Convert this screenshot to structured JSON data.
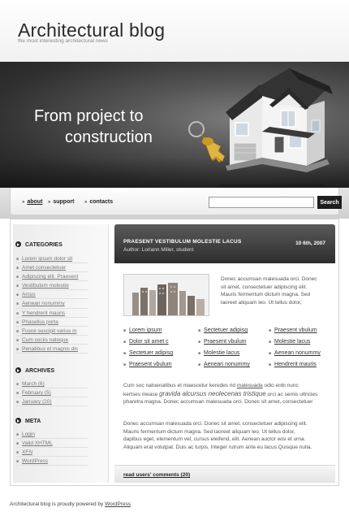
{
  "header": {
    "title": "Architectural blog",
    "tagline": "the most interesting architectural news"
  },
  "banner": {
    "headline_line1": "From project to",
    "headline_line2": "construction"
  },
  "nav": {
    "items": [
      {
        "label": "about",
        "active": true
      },
      {
        "label": "support",
        "active": false
      },
      {
        "label": "contacts",
        "active": false
      }
    ],
    "search_value": "",
    "search_button": "Search"
  },
  "sidebar": {
    "categories": {
      "title": "CATEGORIES",
      "items": [
        "Lorem ipsum dolor sit",
        "Amet consectetuer",
        "Adipiscing elit. Praesent",
        "Vestibulum molestie",
        "Arcus",
        "Aenean nonummy",
        "Y hendrerit mauris",
        "Phasellus porta",
        "Fusce suscipit varius m",
        "Cum sociis natoque",
        "Penatibus et magnis dis"
      ]
    },
    "archives": {
      "title": "ARCHIVES",
      "items": [
        "March (6)",
        "February (5)",
        "January (20)"
      ]
    },
    "meta": {
      "title": "META",
      "items": [
        "Login",
        "Valid XHTML",
        "XFN",
        "WordPress"
      ]
    }
  },
  "post": {
    "title": "PRAESENT VESTIBULUM MOLESTIE LACUS",
    "author": "Author: Lorlann Miller, student",
    "date": "10 6th, 2007",
    "intro_lines": [
      "Donec accumsan malesuada orci. Donec",
      "sit amet, consectetuer adipiscing elit.",
      "Mauris fermentum dictum magna. Sed",
      "laoreet aliquam leo. Ut tellus dolor,"
    ],
    "links": [
      [
        "Lorem ipsum",
        "Sectetuer adipisg",
        "Praesent vbulum"
      ],
      [
        "Dolor sit amet c",
        "Praesent vbulum",
        "Molestie lacus"
      ],
      [
        "Sectetuer adipisg",
        "Molestie lacus",
        "Aenean nonummy"
      ],
      [
        "Praesent vbulum",
        "Aenean nonummy",
        "Hendrerit mauris"
      ]
    ],
    "para2": {
      "line1_before": "Cum soc natoenatibus et maescetur keredes rid",
      "line1_link": "malesuada",
      "line1_after": "odio enbi nunc",
      "line2_before": "kertses mease",
      "line2_em": "gravida alcursus neolecenas tristique",
      "line2_after": "orci ac semis ultricies",
      "line3": "pharetra magna. Donec accumsan malesuada orci. Donec sit amet, consectetuer"
    },
    "para3_lines": [
      "Donec accumsan malesuada orci. Donec sit amet, consectetuer adipiscing elit.",
      "Mauris fermentum dictum magna. Sed laoreet aliquam leo. Ut tellus dolor,",
      "dapibus eget, elementum vel, cursus eleifend, elit. Aenean auctor wisi et urna.",
      "Aliquam erat volutpat. Duis ac turpis. Integer rutrum ante eu lacus.Quisque nulla."
    ],
    "comments_link": "read users' comments (20)"
  },
  "footer": {
    "text": "Architectural blog is proudly powered by",
    "link": "WordPress"
  },
  "colors": {
    "banner_dark": "#2f2f2f",
    "post_header": "#3a3a3a",
    "text": "#555555",
    "key_gold": "#d4a32a"
  }
}
